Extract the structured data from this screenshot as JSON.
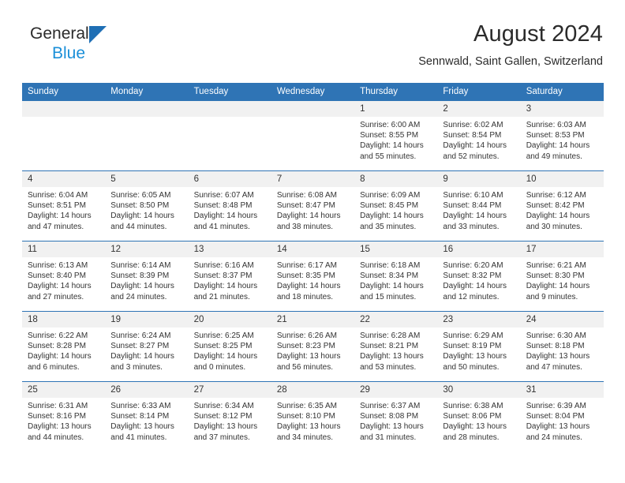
{
  "brand": {
    "word1": "General",
    "word2": "Blue",
    "triangle_color": "#1f6fb5",
    "blue_text_color": "#1a8fd8"
  },
  "header": {
    "title": "August 2024",
    "subtitle": "Sennwald, Saint Gallen, Switzerland"
  },
  "theme": {
    "header_bg": "#2f74b5",
    "daynum_bg": "#f1f1f1",
    "text": "#333333"
  },
  "weekdays": [
    "Sunday",
    "Monday",
    "Tuesday",
    "Wednesday",
    "Thursday",
    "Friday",
    "Saturday"
  ],
  "weeks": [
    [
      {
        "empty": true
      },
      {
        "empty": true
      },
      {
        "empty": true
      },
      {
        "empty": true
      },
      {
        "day": "1",
        "sunrise": "Sunrise: 6:00 AM",
        "sunset": "Sunset: 8:55 PM",
        "daylight1": "Daylight: 14 hours",
        "daylight2": "and 55 minutes."
      },
      {
        "day": "2",
        "sunrise": "Sunrise: 6:02 AM",
        "sunset": "Sunset: 8:54 PM",
        "daylight1": "Daylight: 14 hours",
        "daylight2": "and 52 minutes."
      },
      {
        "day": "3",
        "sunrise": "Sunrise: 6:03 AM",
        "sunset": "Sunset: 8:53 PM",
        "daylight1": "Daylight: 14 hours",
        "daylight2": "and 49 minutes."
      }
    ],
    [
      {
        "day": "4",
        "sunrise": "Sunrise: 6:04 AM",
        "sunset": "Sunset: 8:51 PM",
        "daylight1": "Daylight: 14 hours",
        "daylight2": "and 47 minutes."
      },
      {
        "day": "5",
        "sunrise": "Sunrise: 6:05 AM",
        "sunset": "Sunset: 8:50 PM",
        "daylight1": "Daylight: 14 hours",
        "daylight2": "and 44 minutes."
      },
      {
        "day": "6",
        "sunrise": "Sunrise: 6:07 AM",
        "sunset": "Sunset: 8:48 PM",
        "daylight1": "Daylight: 14 hours",
        "daylight2": "and 41 minutes."
      },
      {
        "day": "7",
        "sunrise": "Sunrise: 6:08 AM",
        "sunset": "Sunset: 8:47 PM",
        "daylight1": "Daylight: 14 hours",
        "daylight2": "and 38 minutes."
      },
      {
        "day": "8",
        "sunrise": "Sunrise: 6:09 AM",
        "sunset": "Sunset: 8:45 PM",
        "daylight1": "Daylight: 14 hours",
        "daylight2": "and 35 minutes."
      },
      {
        "day": "9",
        "sunrise": "Sunrise: 6:10 AM",
        "sunset": "Sunset: 8:44 PM",
        "daylight1": "Daylight: 14 hours",
        "daylight2": "and 33 minutes."
      },
      {
        "day": "10",
        "sunrise": "Sunrise: 6:12 AM",
        "sunset": "Sunset: 8:42 PM",
        "daylight1": "Daylight: 14 hours",
        "daylight2": "and 30 minutes."
      }
    ],
    [
      {
        "day": "11",
        "sunrise": "Sunrise: 6:13 AM",
        "sunset": "Sunset: 8:40 PM",
        "daylight1": "Daylight: 14 hours",
        "daylight2": "and 27 minutes."
      },
      {
        "day": "12",
        "sunrise": "Sunrise: 6:14 AM",
        "sunset": "Sunset: 8:39 PM",
        "daylight1": "Daylight: 14 hours",
        "daylight2": "and 24 minutes."
      },
      {
        "day": "13",
        "sunrise": "Sunrise: 6:16 AM",
        "sunset": "Sunset: 8:37 PM",
        "daylight1": "Daylight: 14 hours",
        "daylight2": "and 21 minutes."
      },
      {
        "day": "14",
        "sunrise": "Sunrise: 6:17 AM",
        "sunset": "Sunset: 8:35 PM",
        "daylight1": "Daylight: 14 hours",
        "daylight2": "and 18 minutes."
      },
      {
        "day": "15",
        "sunrise": "Sunrise: 6:18 AM",
        "sunset": "Sunset: 8:34 PM",
        "daylight1": "Daylight: 14 hours",
        "daylight2": "and 15 minutes."
      },
      {
        "day": "16",
        "sunrise": "Sunrise: 6:20 AM",
        "sunset": "Sunset: 8:32 PM",
        "daylight1": "Daylight: 14 hours",
        "daylight2": "and 12 minutes."
      },
      {
        "day": "17",
        "sunrise": "Sunrise: 6:21 AM",
        "sunset": "Sunset: 8:30 PM",
        "daylight1": "Daylight: 14 hours",
        "daylight2": "and 9 minutes."
      }
    ],
    [
      {
        "day": "18",
        "sunrise": "Sunrise: 6:22 AM",
        "sunset": "Sunset: 8:28 PM",
        "daylight1": "Daylight: 14 hours",
        "daylight2": "and 6 minutes."
      },
      {
        "day": "19",
        "sunrise": "Sunrise: 6:24 AM",
        "sunset": "Sunset: 8:27 PM",
        "daylight1": "Daylight: 14 hours",
        "daylight2": "and 3 minutes."
      },
      {
        "day": "20",
        "sunrise": "Sunrise: 6:25 AM",
        "sunset": "Sunset: 8:25 PM",
        "daylight1": "Daylight: 14 hours",
        "daylight2": "and 0 minutes."
      },
      {
        "day": "21",
        "sunrise": "Sunrise: 6:26 AM",
        "sunset": "Sunset: 8:23 PM",
        "daylight1": "Daylight: 13 hours",
        "daylight2": "and 56 minutes."
      },
      {
        "day": "22",
        "sunrise": "Sunrise: 6:28 AM",
        "sunset": "Sunset: 8:21 PM",
        "daylight1": "Daylight: 13 hours",
        "daylight2": "and 53 minutes."
      },
      {
        "day": "23",
        "sunrise": "Sunrise: 6:29 AM",
        "sunset": "Sunset: 8:19 PM",
        "daylight1": "Daylight: 13 hours",
        "daylight2": "and 50 minutes."
      },
      {
        "day": "24",
        "sunrise": "Sunrise: 6:30 AM",
        "sunset": "Sunset: 8:18 PM",
        "daylight1": "Daylight: 13 hours",
        "daylight2": "and 47 minutes."
      }
    ],
    [
      {
        "day": "25",
        "sunrise": "Sunrise: 6:31 AM",
        "sunset": "Sunset: 8:16 PM",
        "daylight1": "Daylight: 13 hours",
        "daylight2": "and 44 minutes."
      },
      {
        "day": "26",
        "sunrise": "Sunrise: 6:33 AM",
        "sunset": "Sunset: 8:14 PM",
        "daylight1": "Daylight: 13 hours",
        "daylight2": "and 41 minutes."
      },
      {
        "day": "27",
        "sunrise": "Sunrise: 6:34 AM",
        "sunset": "Sunset: 8:12 PM",
        "daylight1": "Daylight: 13 hours",
        "daylight2": "and 37 minutes."
      },
      {
        "day": "28",
        "sunrise": "Sunrise: 6:35 AM",
        "sunset": "Sunset: 8:10 PM",
        "daylight1": "Daylight: 13 hours",
        "daylight2": "and 34 minutes."
      },
      {
        "day": "29",
        "sunrise": "Sunrise: 6:37 AM",
        "sunset": "Sunset: 8:08 PM",
        "daylight1": "Daylight: 13 hours",
        "daylight2": "and 31 minutes."
      },
      {
        "day": "30",
        "sunrise": "Sunrise: 6:38 AM",
        "sunset": "Sunset: 8:06 PM",
        "daylight1": "Daylight: 13 hours",
        "daylight2": "and 28 minutes."
      },
      {
        "day": "31",
        "sunrise": "Sunrise: 6:39 AM",
        "sunset": "Sunset: 8:04 PM",
        "daylight1": "Daylight: 13 hours",
        "daylight2": "and 24 minutes."
      }
    ]
  ]
}
